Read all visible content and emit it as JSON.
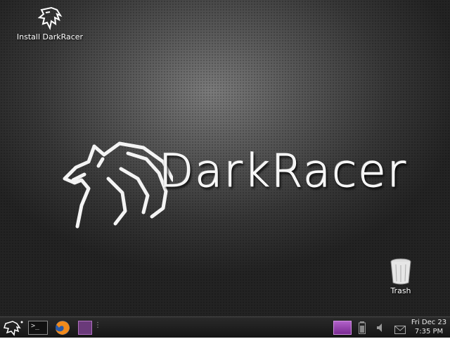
{
  "desktop": {
    "icons": [
      {
        "label": "Install DarkRacer"
      },
      {
        "label": "Trash"
      }
    ],
    "wallpaper_logo_text": "DarkRacer"
  },
  "taskbar": {
    "clock": {
      "day": "Fri Dec 23",
      "time": "7:35 PM"
    },
    "terminal_glyph": ">_",
    "pager_handle": "⋮"
  },
  "colors": {
    "pager_accent": "#b060c8",
    "taskbar_bg": "#1c1c1c"
  }
}
